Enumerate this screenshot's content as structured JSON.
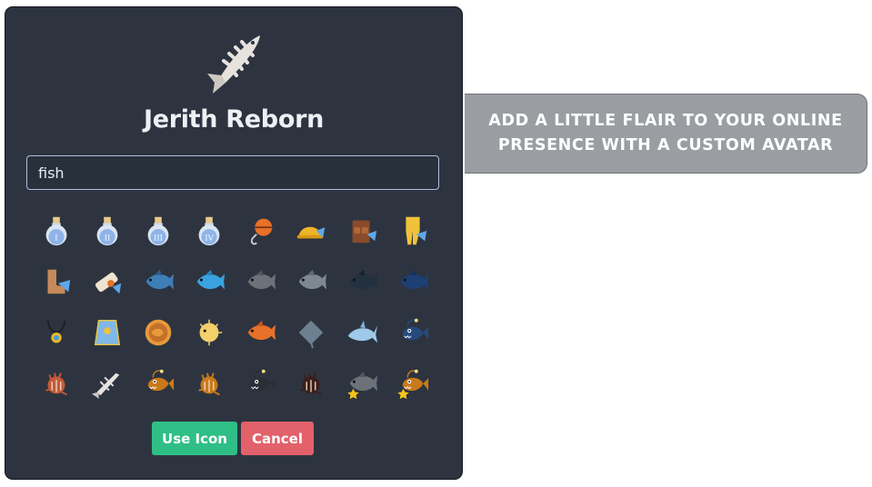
{
  "dialog": {
    "title": "Jerith Reborn",
    "search_value": "fish",
    "use_label": "Use Icon",
    "cancel_label": "Cancel"
  },
  "colors": {
    "dialog_bg": "#2d3440",
    "use_button": "#2fbf86",
    "cancel_button": "#e2616a",
    "callout_bg": "#9a9da1"
  },
  "icons": [
    "potion-1-icon",
    "potion-2-icon",
    "potion-3-icon",
    "potion-4-icon",
    "fishing-bobber-icon",
    "fishing-hat-icon",
    "fishing-vest-icon",
    "fishing-waders-icon",
    "fishing-boots-icon",
    "fishing-scroll-icon",
    "swordfish-icon",
    "tuna-icon",
    "grey-swordfish-icon",
    "grey-fish-icon",
    "dark-fish-icon",
    "dark-fish-icon-2",
    "fish-amulet-icon",
    "fish-cape-icon",
    "fish-coin-icon",
    "pufferfish-icon",
    "koi-fish-icon",
    "stingray-icon",
    "shark-icon",
    "anglerfish-icon",
    "lionfish-icon",
    "fish-bones-icon",
    "orange-anglerfish-icon",
    "orange-lionfish-icon",
    "black-anglerfish-icon",
    "dark-lionfish-icon",
    "swordfish-star-icon",
    "anglerfish-star-icon"
  ],
  "callout": {
    "line1": "ADD A LITTLE FLAIR TO YOUR ONLINE",
    "line2": "PRESENCE WITH A CUSTOM AVATAR"
  }
}
